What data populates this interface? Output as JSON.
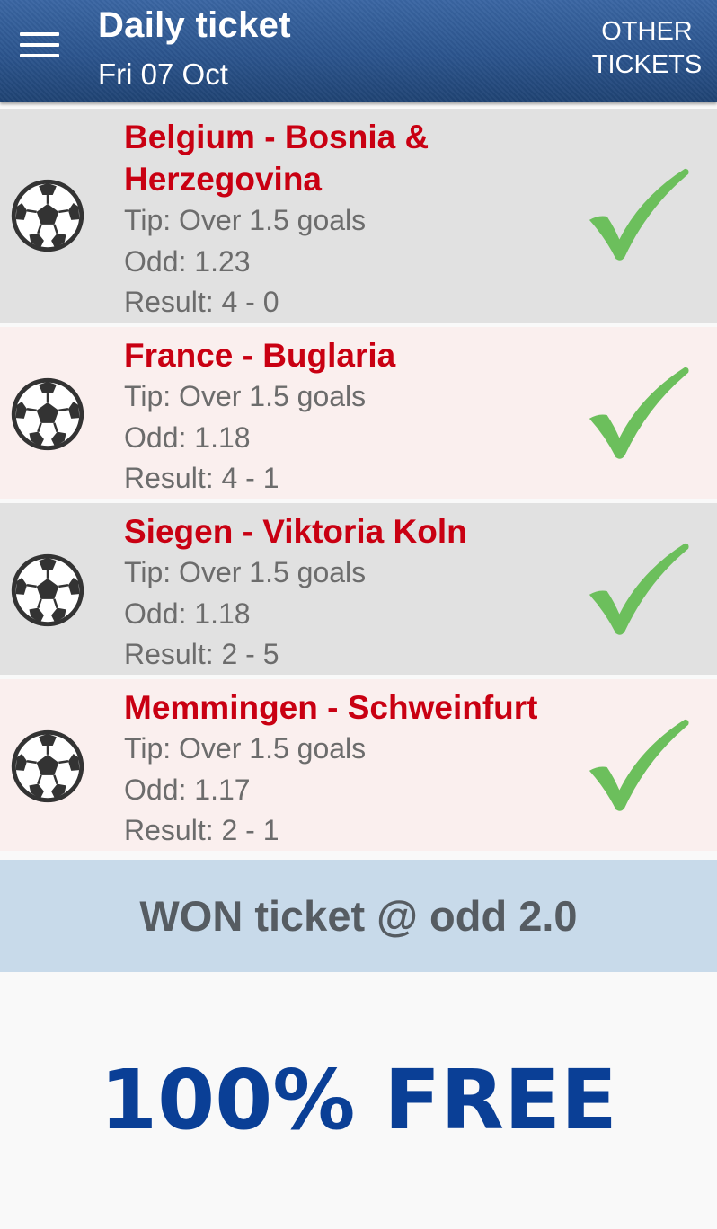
{
  "header": {
    "title": "Daily ticket",
    "date": "Fri 07 Oct",
    "other_tickets": [
      "OTHER",
      "TICKETS"
    ],
    "menu_icon": "hamburger-menu-icon",
    "color": "#2b548d"
  },
  "matches": [
    {
      "teams": "Belgium - Bosnia & Herzegovina",
      "tip": "Tip: Over 1.5 goals",
      "odd": "Odd: 1.23",
      "result": "Result: 4 - 0",
      "status_icon": "check-icon",
      "sport_icon": "soccer-ball-icon"
    },
    {
      "teams": "France - Buglaria",
      "tip": "Tip: Over 1.5 goals",
      "odd": "Odd: 1.18",
      "result": "Result: 4 - 1",
      "status_icon": "check-icon",
      "sport_icon": "soccer-ball-icon"
    },
    {
      "teams": "Siegen - Viktoria Koln",
      "tip": "Tip: Over 1.5 goals",
      "odd": "Odd: 1.18",
      "result": "Result: 2 - 5",
      "status_icon": "check-icon",
      "sport_icon": "soccer-ball-icon"
    },
    {
      "teams": "Memmingen - Schweinfurt",
      "tip": "Tip: Over 1.5 goals",
      "odd": "Odd: 1.17",
      "result": "Result: 2 - 1",
      "status_icon": "check-icon",
      "sport_icon": "soccer-ball-icon"
    }
  ],
  "summary": "WON ticket @ odd 2.0",
  "banner": "100% FREE",
  "colors": {
    "match_title": "#c90012",
    "check": "#6cbf5c",
    "row_gray": "#e1e1e1",
    "row_pink": "#faefee",
    "summary_bg": "#c8daea",
    "banner_text": "#0a3f96"
  }
}
